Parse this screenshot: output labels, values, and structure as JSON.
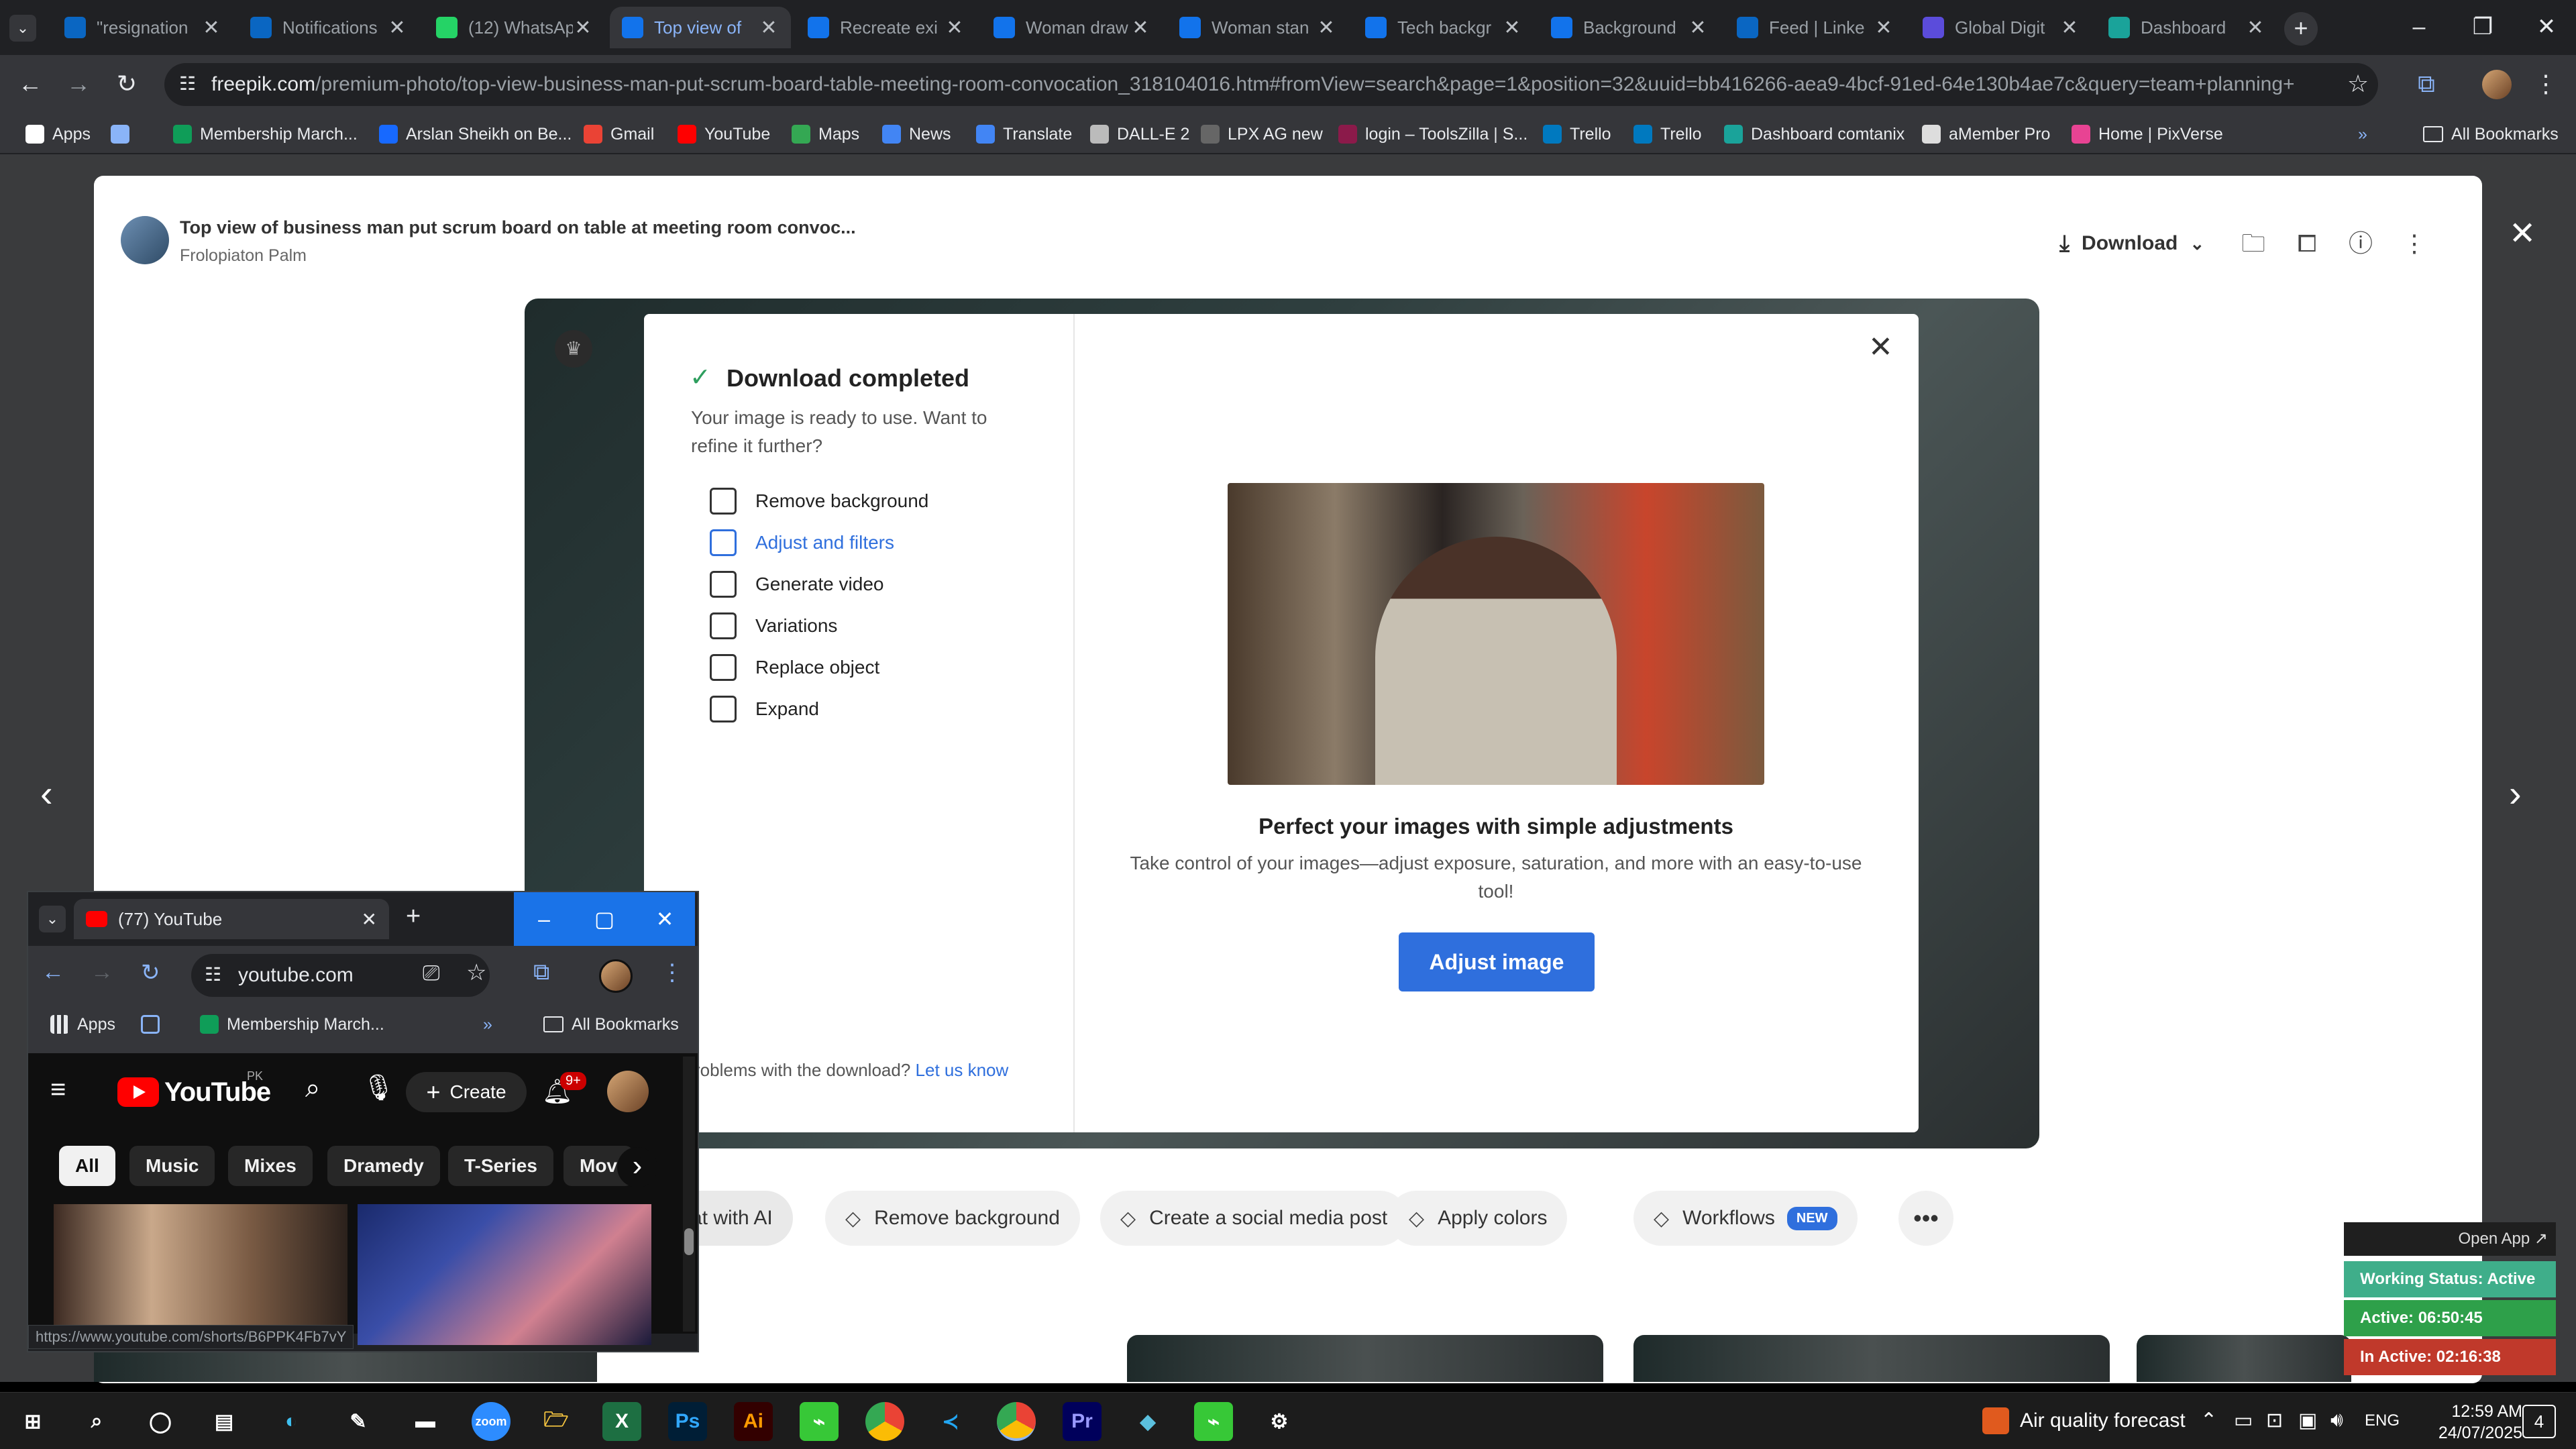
{
  "browser": {
    "tabs": [
      {
        "title": "\"resignation",
        "favicon": "linkedin-icon",
        "color": "#0a66c2"
      },
      {
        "title": "Notifications",
        "favicon": "linkedin-icon",
        "color": "#0a66c2"
      },
      {
        "title": "(12) WhatsApp",
        "favicon": "whatsapp-icon",
        "color": "#25d366"
      },
      {
        "title": "Top view of",
        "favicon": "freepik-icon",
        "color": "#1273eb",
        "active": true
      },
      {
        "title": "Recreate exi",
        "favicon": "freepik-icon",
        "color": "#1273eb"
      },
      {
        "title": "Woman draw",
        "favicon": "freepik-icon",
        "color": "#1273eb"
      },
      {
        "title": "Woman stan",
        "favicon": "freepik-icon",
        "color": "#1273eb"
      },
      {
        "title": "Tech backgr",
        "favicon": "freepik-icon",
        "color": "#1273eb"
      },
      {
        "title": "Background",
        "favicon": "freepik-icon",
        "color": "#1273eb"
      },
      {
        "title": "Feed | Linke",
        "favicon": "linkedin-icon",
        "color": "#0a66c2"
      },
      {
        "title": "Global Digit",
        "favicon": "x-brand-icon",
        "color": "#5b4cdb"
      },
      {
        "title": "Dashboard",
        "favicon": "dashboard-icon",
        "color": "#1aa39a"
      }
    ],
    "url_domain": "freepik.com",
    "url_path": "/premium-photo/top-view-business-man-put-scrum-board-table-meeting-room-convocation_318104016.htm#fromView=search&page=1&position=32&uuid=bb416266-aea9-4bcf-91ed-64e130b4ae7c&query=team+planning+",
    "bookmarks": [
      {
        "label": "Apps",
        "icon": "apps-grid-icon",
        "color": "#ffffff"
      },
      {
        "label": "",
        "icon": "tab-groups-icon",
        "color": "#8ab4f8"
      },
      {
        "label": "Membership March...",
        "icon": "sheets-icon",
        "color": "#0f9d58"
      },
      {
        "label": "Arslan Sheikh on Be...",
        "icon": "behance-icon",
        "color": "#1769ff"
      },
      {
        "label": "Gmail",
        "icon": "gmail-icon",
        "color": "#ea4335"
      },
      {
        "label": "YouTube",
        "icon": "youtube-icon",
        "color": "#ff0000"
      },
      {
        "label": "Maps",
        "icon": "maps-icon",
        "color": "#34a853"
      },
      {
        "label": "News",
        "icon": "news-icon",
        "color": "#4285f4"
      },
      {
        "label": "Translate",
        "icon": "translate-icon",
        "color": "#4285f4"
      },
      {
        "label": "DALL-E 2",
        "icon": "openai-icon",
        "color": "#bbbbbb"
      },
      {
        "label": "LPX AG new",
        "icon": "globe-icon",
        "color": "#666666"
      },
      {
        "label": "login – ToolsZilla | S...",
        "icon": "toolszilla-icon",
        "color": "#8b1a4a"
      },
      {
        "label": "Trello",
        "icon": "trello-icon",
        "color": "#0079bf"
      },
      {
        "label": "Trello",
        "icon": "trello-icon",
        "color": "#0079bf"
      },
      {
        "label": "Dashboard comtanix",
        "icon": "dashboard-icon",
        "color": "#1aa39a"
      },
      {
        "label": "aMember Pro",
        "icon": "amember-icon",
        "color": "#dddddd"
      },
      {
        "label": "Home | PixVerse",
        "icon": "pixverse-icon",
        "color": "#e84393"
      }
    ],
    "all_bookmarks": "All Bookmarks"
  },
  "viewer": {
    "title": "Top view of business man put scrum board on table at meeting room convoc...",
    "author": "Frolopiaton Palm",
    "download_label": "Download"
  },
  "modal": {
    "heading": "Download completed",
    "description": "Your image is ready to use. Want to refine it further?",
    "options": [
      {
        "label": "Remove background",
        "icon": "remove-background-icon"
      },
      {
        "label": "Adjust and filters",
        "icon": "sliders-icon",
        "selected": true
      },
      {
        "label": "Generate video",
        "icon": "video-camera-icon"
      },
      {
        "label": "Variations",
        "icon": "refresh-icon"
      },
      {
        "label": "Replace object",
        "icon": "replace-object-icon"
      },
      {
        "label": "Expand",
        "icon": "expand-icon"
      }
    ],
    "problem_text": "roblems with the download?",
    "problem_link": "Let us know",
    "adjust_title": "Perfect your images with simple adjustments",
    "adjust_desc": "Take control of your images—adjust exposure, saturation, and more with an easy-to-use tool!",
    "adjust_button": "Adjust image"
  },
  "actions": [
    {
      "label": "at with AI",
      "icon": ""
    },
    {
      "label": "Remove background",
      "icon": "remove-background-icon"
    },
    {
      "label": "Create a social media post",
      "icon": "phone-icon"
    },
    {
      "label": "Apply colors",
      "icon": "palette-icon"
    },
    {
      "label": "Workflows",
      "icon": "workflow-icon",
      "badge": "NEW"
    }
  ],
  "youtube_window": {
    "tab_title": "(77) YouTube",
    "url": "youtube.com",
    "bookmarks": [
      "Apps",
      "Membership March..."
    ],
    "all_bookmarks": "All Bookmarks",
    "logo_text": "YouTube",
    "region": "PK",
    "create_label": "Create",
    "notif_count": "9+",
    "chips": [
      "All",
      "Music",
      "Mixes",
      "Dramedy",
      "T-Series",
      "Mov"
    ],
    "status_url": "https://www.youtube.com/shorts/B6PPK4Fb7vY"
  },
  "tracker": {
    "open_app": "Open App ↗",
    "working_status": "Working Status: Active",
    "active": "Active: 06:50:45",
    "inactive": "In Active: 02:16:38",
    "colors": {
      "status": "#3fae8a",
      "active": "#2ea04a",
      "inactive": "#c0392b"
    }
  },
  "taskbar": {
    "weather": "Air quality forecast",
    "lang": "ENG",
    "time": "12:59 AM",
    "date": "24/07/2025",
    "notif_count": "4"
  }
}
